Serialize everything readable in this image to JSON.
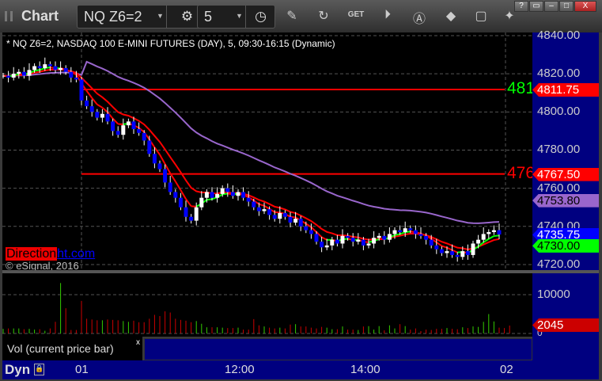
{
  "window": {
    "title": "Chart",
    "symbol": "NQ Z6=2",
    "interval": "5",
    "win_buttons": [
      "?",
      "▭",
      "–",
      "□",
      "X"
    ]
  },
  "toolbar_icons": [
    "pencil-icon",
    "refresh-chart-icon",
    "get-icon",
    "play-icon",
    "alert-icon",
    "link-icon",
    "comment-icon",
    "twitter-icon"
  ],
  "chart_title": "* NQ Z6=2, NASDAQ 100 E-MINI FUTURES (DAY), 5, 09:30-16:15 (Dynamic)",
  "logo": {
    "red": "Direction",
    "blue": "ht.com"
  },
  "copyright": "© eSignal, 2016",
  "price_axis": {
    "ticks": [
      "4840.00",
      "4820.00",
      "4800.00",
      "4780.00",
      "4760.00",
      "4740.00",
      "4720.00"
    ],
    "tick_values": [
      4840,
      4820,
      4800,
      4780,
      4760,
      4740,
      4720
    ]
  },
  "price_tags": [
    {
      "text": "4811.75",
      "value": 4811.75,
      "bg": "#ff0000",
      "fg": "#ffffff"
    },
    {
      "text": "4767.50",
      "value": 4767.5,
      "bg": "#ff0000",
      "fg": "#ffffff"
    },
    {
      "text": "4753.80",
      "value": 4753.8,
      "bg": "#9966cc",
      "fg": "#000000"
    },
    {
      "text": "4735.75",
      "value": 4735.75,
      "bg": "#0000ff",
      "fg": "#ffffff"
    },
    {
      "text": "4730.00",
      "value": 4730,
      "bg": "#00ff00",
      "fg": "#000000"
    }
  ],
  "levels": [
    {
      "label": "481",
      "value": 4811.75,
      "color": "#00ff00"
    },
    {
      "label": "476",
      "value": 4767.5,
      "color": "#ff0000"
    }
  ],
  "volume_axis": {
    "ticks": [
      "10000",
      "0"
    ],
    "last_tag": "2045"
  },
  "volume_legend": "Vol (current price bar)",
  "legend_close": "x",
  "time_axis": {
    "mode": "Dyn",
    "labels": [
      "01",
      "12:00",
      "14:00",
      "02"
    ]
  },
  "chart_data": {
    "type": "candlestick",
    "closes": [
      4819,
      4818,
      4820,
      4821,
      4819,
      4822,
      4824,
      4823,
      4825,
      4824,
      4822,
      4823,
      4821,
      4818,
      4817,
      4806,
      4803,
      4800,
      4797,
      4799,
      4795,
      4790,
      4788,
      4793,
      4795,
      4791,
      4789,
      4785,
      4778,
      4773,
      4770,
      4763,
      4758,
      4755,
      4750,
      4745,
      4743,
      4750,
      4755,
      4758,
      4755,
      4757,
      4760,
      4758,
      4756,
      4758,
      4755,
      4753,
      4750,
      4748,
      4749,
      4746,
      4744,
      4747,
      4745,
      4742,
      4744,
      4740,
      4738,
      4736,
      4732,
      4729,
      4730,
      4733,
      4731,
      4735,
      4734,
      4732,
      4733,
      4730,
      4731,
      4734,
      4735,
      4733,
      4736,
      4738,
      4737,
      4739,
      4738,
      4736,
      4735,
      4733,
      4730,
      4728,
      4726,
      4727,
      4725,
      4724,
      4727,
      4725,
      4731,
      4733,
      4736,
      4737,
      4738,
      4735.75
    ],
    "volumes": [
      1200,
      1300,
      1300,
      1300,
      1100,
      1200,
      1000,
      1100,
      700,
      1300,
      3000,
      13000,
      6500,
      900,
      900,
      8400,
      3800,
      3600,
      3400,
      3400,
      3600,
      3500,
      3400,
      3200,
      3000,
      3300,
      2900,
      2900,
      3800,
      4800,
      4500,
      5700,
      5400,
      3800,
      3500,
      3300,
      2900,
      3200,
      2500,
      1600,
      1600,
      1600,
      1500,
      1400,
      1400,
      1500,
      1000,
      1000,
      3700,
      2100,
      1800,
      1500,
      1300,
      1500,
      1300,
      2300,
      2400,
      1800,
      1800,
      1500,
      1300,
      1700,
      1500,
      1100,
      1100,
      1800,
      1000,
      1000,
      900,
      1800,
      1900,
      1000,
      1900,
      800,
      2100,
      1300,
      2400,
      1900,
      1000,
      1300,
      600,
      1000,
      900,
      1200,
      1200,
      1400,
      1200,
      1100,
      1600,
      1400,
      1800,
      1700,
      3000,
      5000,
      3100,
      1500,
      1400,
      2045
    ],
    "ylim": [
      4716,
      4842
    ],
    "volume_ylim": [
      0,
      13500
    ],
    "x_labels": [
      "01",
      "12:00",
      "14:00",
      "02"
    ],
    "series": [
      {
        "name": "Fast MA",
        "color": "#00ff00/#ff0000"
      },
      {
        "name": "Slow MA",
        "color": "#ff0000"
      },
      {
        "name": "Long MA",
        "color": "#9966cc"
      }
    ]
  }
}
